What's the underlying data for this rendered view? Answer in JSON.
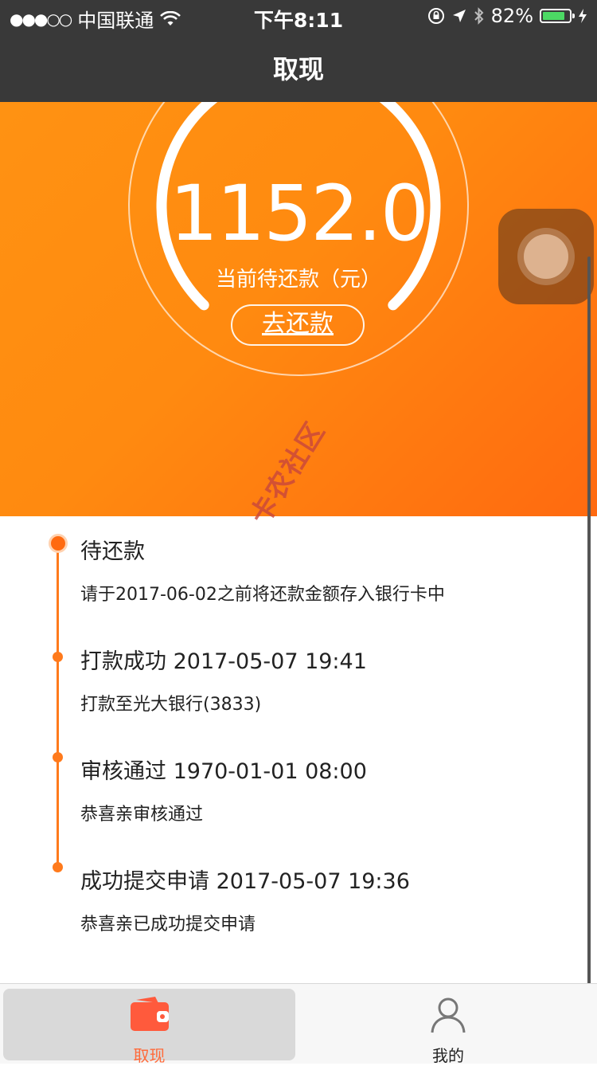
{
  "status_bar": {
    "signal": "●●●○○",
    "carrier": "中国联通",
    "time": "下午8:11",
    "battery_percent": "82%",
    "battery_level": 0.82
  },
  "nav": {
    "title": "取现"
  },
  "hero": {
    "amount": "1152.0",
    "amount_label": "当前待还款（元）",
    "repay_button": "去还款"
  },
  "timeline": [
    {
      "title": "待还款",
      "desc": "请于2017-06-02之前将还款金额存入银行卡中",
      "active": true
    },
    {
      "title": "打款成功 2017-05-07 19:41",
      "desc": "打款至光大银行(3833)",
      "active": false
    },
    {
      "title": "审核通过 1970-01-01 08:00",
      "desc": "恭喜亲审核通过",
      "active": false
    },
    {
      "title": "成功提交申请 2017-05-07 19:36",
      "desc": "恭喜亲已成功提交申请",
      "active": false
    }
  ],
  "watermark": "卡农社区",
  "tabbar": {
    "tabs": [
      {
        "label": "取现",
        "icon": "wallet-icon",
        "active": true
      },
      {
        "label": "我的",
        "icon": "user-icon",
        "active": false
      }
    ]
  },
  "colors": {
    "accent": "#ff7a1c",
    "nav_bg": "#393939",
    "active_tab_label": "#ff6a3a"
  }
}
